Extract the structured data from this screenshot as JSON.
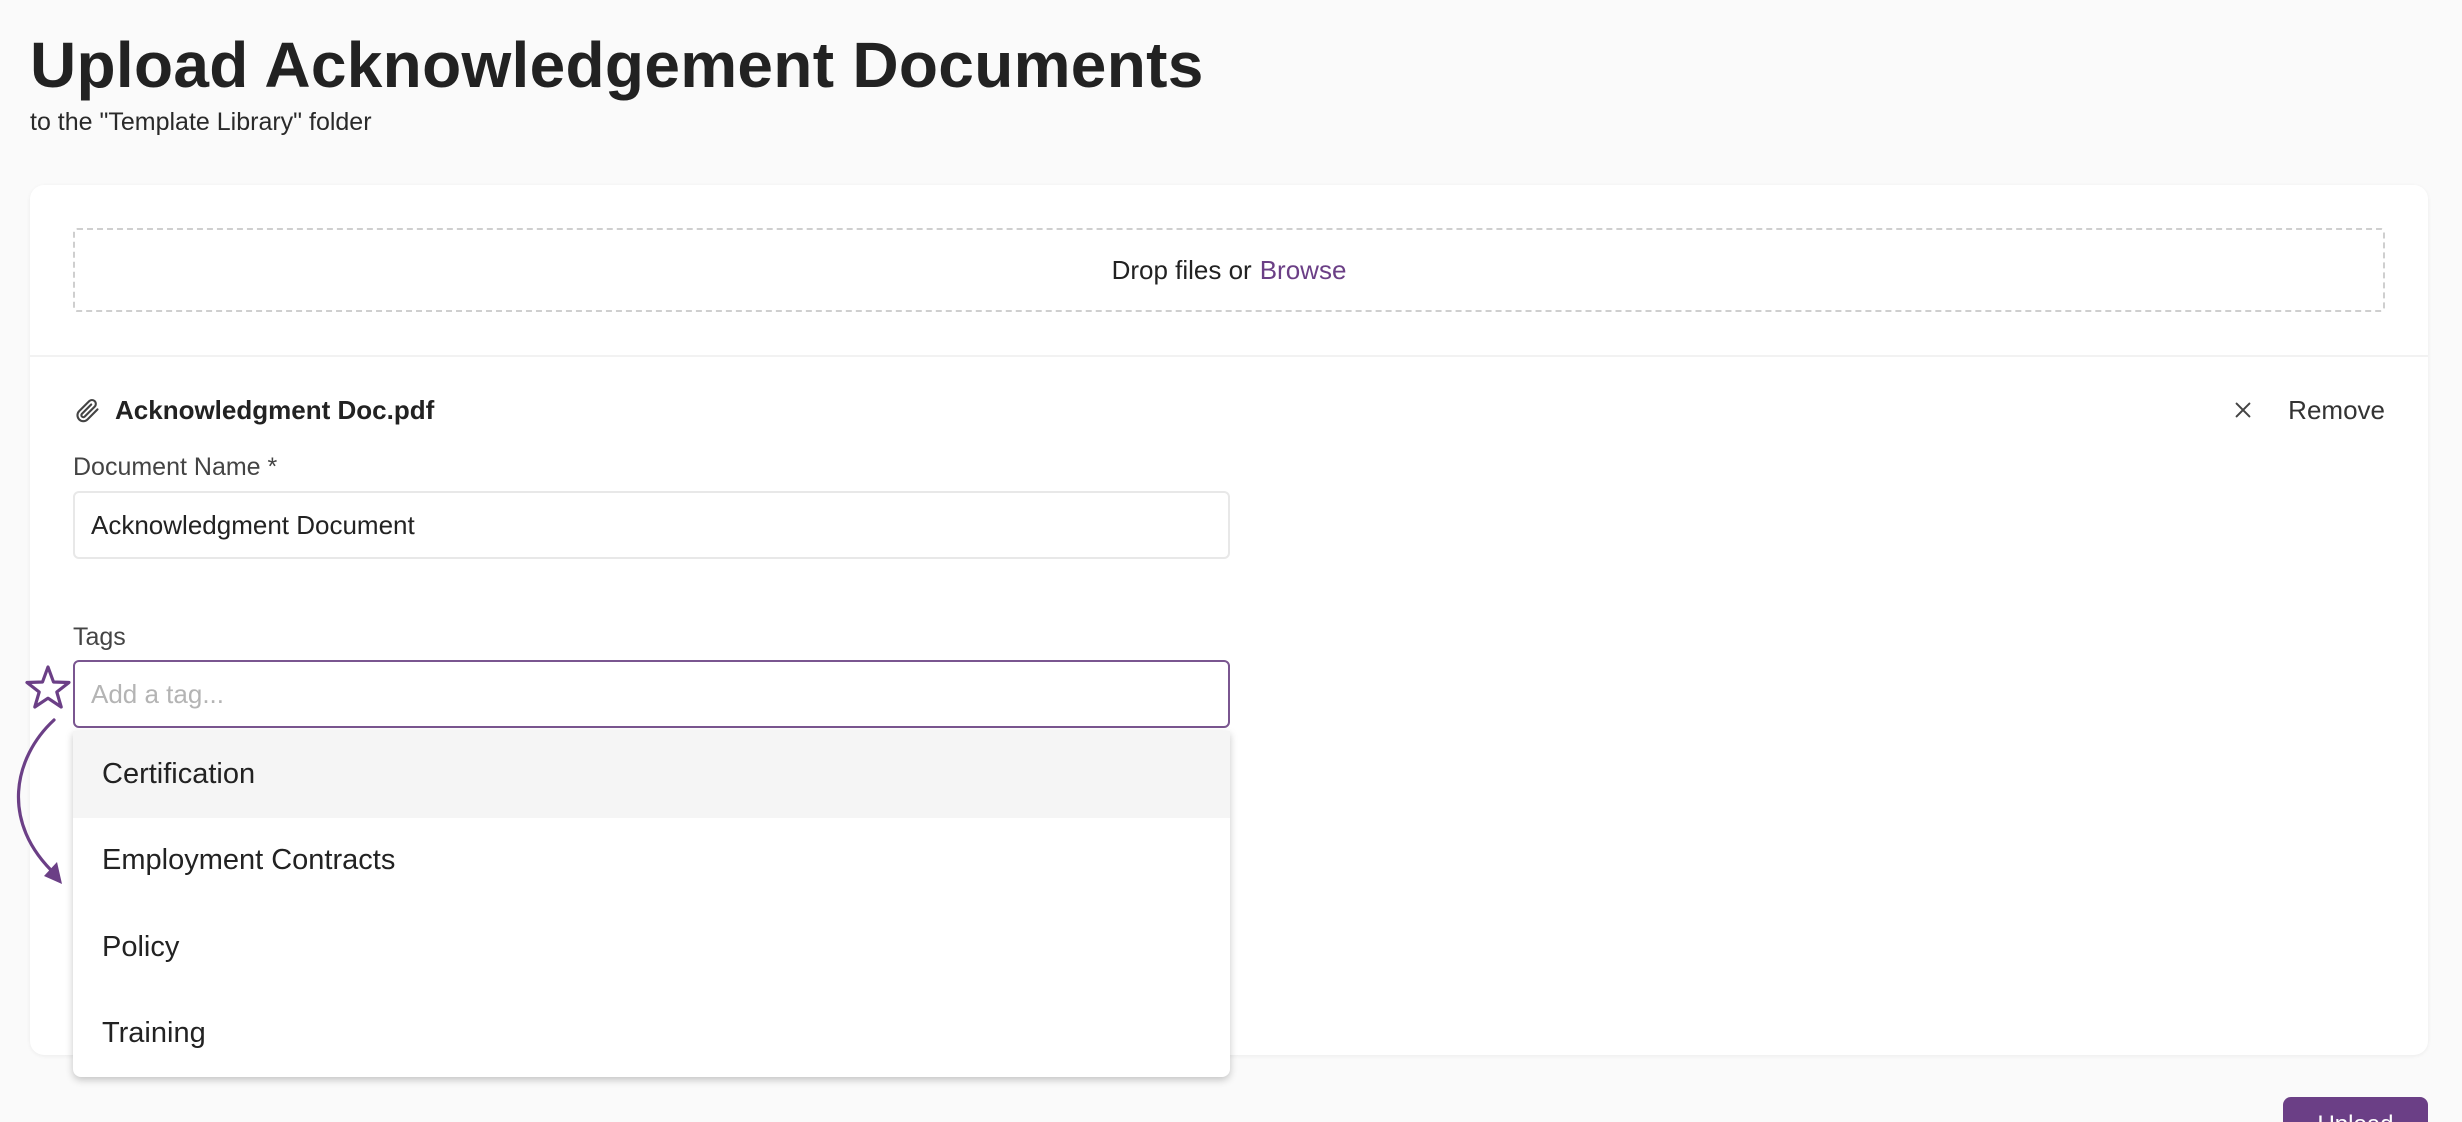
{
  "header": {
    "title": "Upload Acknowledgement Documents",
    "subtitle": "to the \"Template Library\" folder"
  },
  "dropzone": {
    "text": "Drop files or",
    "browse_label": "Browse"
  },
  "file": {
    "name": "Acknowledgment Doc.pdf",
    "remove_label": "Remove"
  },
  "document_name": {
    "label": "Document Name *",
    "value": "Acknowledgment Document"
  },
  "tags": {
    "label": "Tags",
    "placeholder": "Add a tag...",
    "options": [
      {
        "label": "Certification"
      },
      {
        "label": "Employment Contracts"
      },
      {
        "label": "Policy"
      },
      {
        "label": "Training"
      }
    ]
  },
  "actions": {
    "upload_label": "Upload"
  },
  "colors": {
    "accent": "#6b3f86",
    "focus_border": "#7a5690"
  },
  "icons": [
    "paperclip-icon",
    "close-icon",
    "star-icon",
    "curved-arrow-icon"
  ]
}
